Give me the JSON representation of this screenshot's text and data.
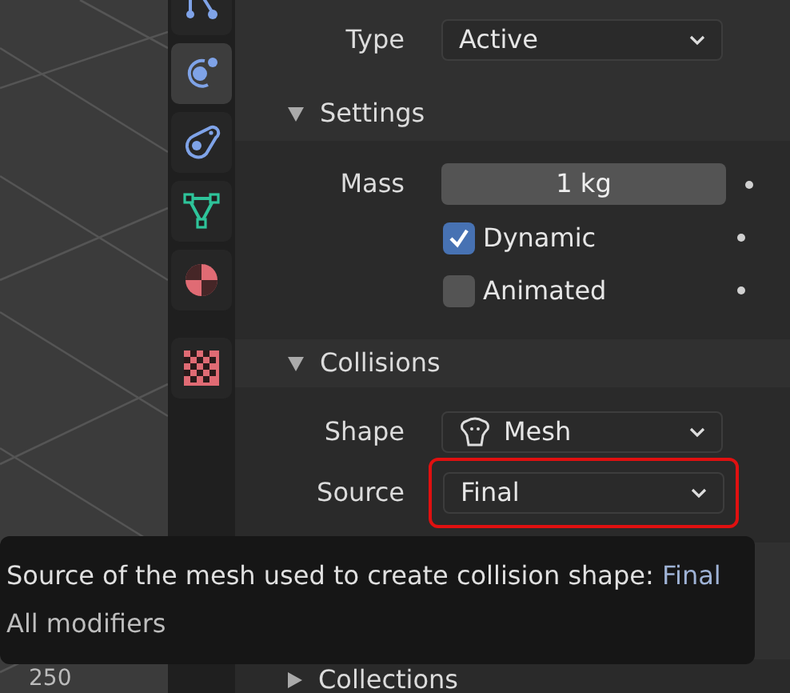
{
  "viewport": {
    "axis_label": "250"
  },
  "tabs": [
    {
      "selected": false
    },
    {
      "selected": true
    },
    {
      "selected": false
    },
    {
      "selected": false
    },
    {
      "selected": false
    },
    {
      "selected": false
    }
  ],
  "type_row": {
    "label": "Type",
    "value": "Active"
  },
  "settings": {
    "title": "Settings",
    "expanded": true,
    "mass": {
      "label": "Mass",
      "value": "1 kg"
    },
    "checkboxes": [
      {
        "label": "Dynamic",
        "checked": true
      },
      {
        "label": "Animated",
        "checked": false
      }
    ]
  },
  "collisions": {
    "title": "Collisions",
    "expanded": true,
    "shape": {
      "label": "Shape",
      "value": "Mesh"
    },
    "source": {
      "label": "Source",
      "value": "Final",
      "highlighted": true
    }
  },
  "subpanels": [
    {
      "title": "Collections",
      "expanded": false
    }
  ],
  "tooltip": {
    "description": "Source of the mesh used to create collision shape:",
    "value": "Final",
    "detail": "All modifiers"
  }
}
